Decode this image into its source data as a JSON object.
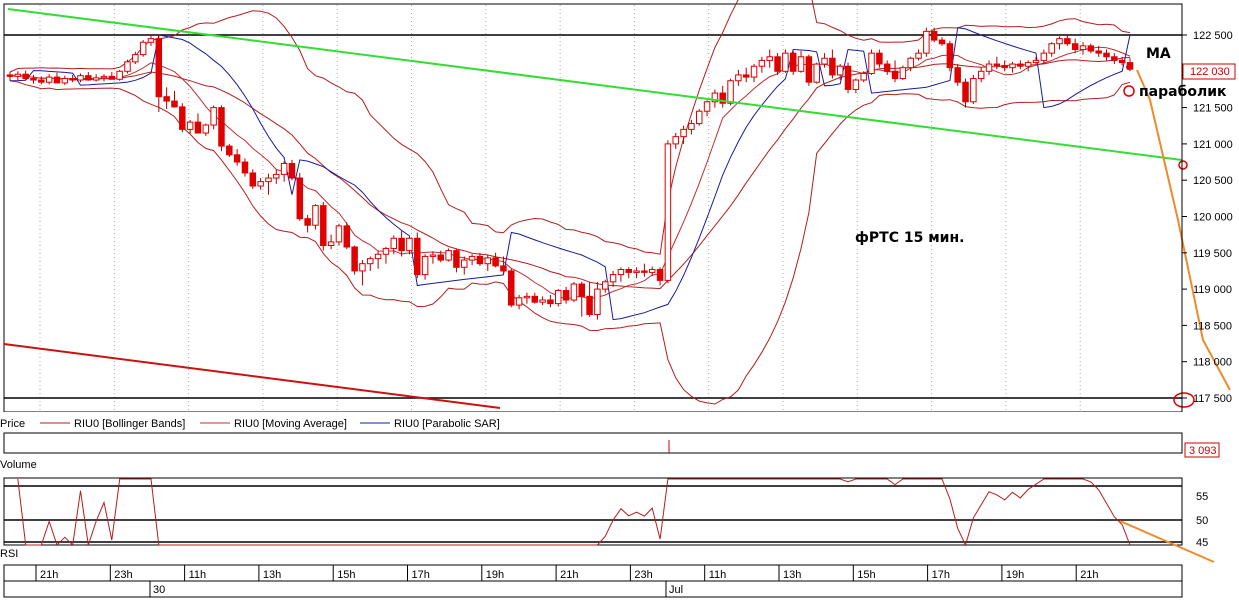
{
  "chart_data": {
    "type": "candlestick",
    "price_panel": {
      "ylim": [
        117500,
        122600
      ],
      "y_ticks": [
        "122 500",
        "122 000",
        "121 500",
        "121 000",
        "120 500",
        "120 000",
        "119 500",
        "119 000",
        "118 500",
        "118 000",
        "117 500"
      ],
      "current_price_label": "122 030",
      "annotations": {
        "ma": "MA",
        "parabolic": "параболик",
        "title": "фРТС   15 мин."
      },
      "legend": [
        "Price",
        "RIU0 [Bollinger Bands]",
        "RIU0 [Moving Average]",
        "RIU0 [Parabolic SAR]"
      ],
      "candles": [
        [
          121950,
          121990,
          121870,
          121930
        ],
        [
          121930,
          122000,
          121880,
          121960
        ],
        [
          121960,
          122010,
          121880,
          121900
        ],
        [
          121900,
          121950,
          121830,
          121880
        ],
        [
          121880,
          121930,
          121820,
          121850
        ],
        [
          121850,
          121960,
          121820,
          121920
        ],
        [
          121920,
          121980,
          121860,
          121840
        ],
        [
          121840,
          121940,
          121810,
          121900
        ],
        [
          121900,
          121950,
          121850,
          121880
        ],
        [
          121880,
          121970,
          121850,
          121940
        ],
        [
          121940,
          121990,
          121870,
          121880
        ],
        [
          121880,
          121960,
          121860,
          121910
        ],
        [
          121910,
          121960,
          121860,
          121930
        ],
        [
          121930,
          121990,
          121890,
          121890
        ],
        [
          121890,
          122020,
          121870,
          122000
        ],
        [
          122000,
          122160,
          121970,
          122130
        ],
        [
          122130,
          122270,
          122100,
          122230
        ],
        [
          122230,
          122430,
          122200,
          122400
        ],
        [
          122400,
          122500,
          122350,
          122450
        ],
        [
          122450,
          122510,
          121440,
          121650
        ],
        [
          121650,
          121780,
          121480,
          121590
        ],
        [
          121590,
          121730,
          121500,
          121510
        ],
        [
          121510,
          121560,
          121160,
          121200
        ],
        [
          121200,
          121330,
          121140,
          121300
        ],
        [
          121300,
          121420,
          121170,
          121150
        ],
        [
          121150,
          121280,
          121110,
          121260
        ],
        [
          121260,
          121530,
          121200,
          121500
        ],
        [
          121500,
          121530,
          120900,
          120970
        ],
        [
          120970,
          121000,
          120820,
          120850
        ],
        [
          120850,
          120930,
          120700,
          120750
        ],
        [
          120750,
          120800,
          120550,
          120600
        ],
        [
          120600,
          120650,
          120380,
          120420
        ],
        [
          120420,
          120530,
          120370,
          120480
        ],
        [
          120480,
          120590,
          120300,
          120530
        ],
        [
          120530,
          120650,
          120450,
          120580
        ],
        [
          120580,
          120760,
          120480,
          120730
        ],
        [
          120730,
          120780,
          120500,
          120530
        ],
        [
          120530,
          120600,
          119940,
          119970
        ],
        [
          119970,
          120020,
          119780,
          119880
        ],
        [
          119880,
          120170,
          119820,
          120150
        ],
        [
          120150,
          120200,
          119530,
          119600
        ],
        [
          119600,
          119750,
          119550,
          119650
        ],
        [
          119650,
          119900,
          119600,
          119870
        ],
        [
          119870,
          119920,
          119550,
          119580
        ],
        [
          119580,
          119600,
          119200,
          119250
        ],
        [
          119250,
          119400,
          119050,
          119350
        ],
        [
          119350,
          119450,
          119250,
          119420
        ],
        [
          119420,
          119530,
          119280,
          119480
        ],
        [
          119480,
          119580,
          119350,
          119560
        ],
        [
          119560,
          119740,
          119480,
          119700
        ],
        [
          119700,
          119800,
          119450,
          119530
        ],
        [
          119530,
          119720,
          119480,
          119700
        ],
        [
          119700,
          119780,
          119150,
          119200
        ],
        [
          119200,
          119480,
          119130,
          119450
        ],
        [
          119450,
          119520,
          119350,
          119470
        ],
        [
          119470,
          119530,
          119370,
          119400
        ],
        [
          119400,
          119560,
          119380,
          119530
        ],
        [
          119530,
          119560,
          119230,
          119300
        ],
        [
          119300,
          119450,
          119200,
          119400
        ],
        [
          119400,
          119480,
          119330,
          119450
        ],
        [
          119450,
          119500,
          119320,
          119350
        ],
        [
          119350,
          119470,
          119250,
          119430
        ],
        [
          119430,
          119500,
          119300,
          119320
        ],
        [
          119320,
          119450,
          119200,
          119250
        ],
        [
          119250,
          119280,
          118750,
          118780
        ],
        [
          118780,
          118920,
          118720,
          118880
        ],
        [
          118880,
          118950,
          118800,
          118900
        ],
        [
          118900,
          118950,
          118800,
          118820
        ],
        [
          118820,
          118900,
          118780,
          118850
        ],
        [
          118850,
          118920,
          118750,
          118800
        ],
        [
          118800,
          119000,
          118760,
          118980
        ],
        [
          118980,
          119030,
          118800,
          118850
        ],
        [
          118850,
          119100,
          118820,
          119070
        ],
        [
          119070,
          119100,
          118620,
          118900
        ],
        [
          118900,
          119100,
          118620,
          118650
        ],
        [
          118650,
          119100,
          118580,
          119000
        ],
        [
          119000,
          119130,
          118950,
          119100
        ],
        [
          119100,
          119250,
          119030,
          119200
        ],
        [
          119200,
          119300,
          119100,
          119270
        ],
        [
          119270,
          119300,
          119150,
          119230
        ],
        [
          119230,
          119300,
          119150,
          119250
        ],
        [
          119250,
          119350,
          119170,
          119230
        ],
        [
          119230,
          119310,
          119180,
          119270
        ],
        [
          119270,
          119300,
          119050,
          119120
        ],
        [
          119120,
          121050,
          119080,
          121000
        ],
        [
          121000,
          121150,
          120930,
          121100
        ],
        [
          121100,
          121250,
          121000,
          121200
        ],
        [
          121200,
          121330,
          121130,
          121280
        ],
        [
          121280,
          121480,
          121250,
          121450
        ],
        [
          121450,
          121600,
          121380,
          121580
        ],
        [
          121580,
          121750,
          121500,
          121700
        ],
        [
          121700,
          121800,
          121500,
          121560
        ],
        [
          121560,
          121900,
          121530,
          121870
        ],
        [
          121870,
          122020,
          121800,
          121950
        ],
        [
          121950,
          122050,
          121850,
          121920
        ],
        [
          121920,
          122100,
          121850,
          122070
        ],
        [
          122070,
          122200,
          121980,
          122150
        ],
        [
          122150,
          122300,
          122050,
          122200
        ],
        [
          122200,
          122250,
          121950,
          122000
        ],
        [
          122000,
          122300,
          121980,
          122250
        ],
        [
          122250,
          122280,
          121950,
          122000
        ],
        [
          122000,
          122280,
          121980,
          122200
        ],
        [
          122200,
          122230,
          121800,
          121850
        ],
        [
          121850,
          122120,
          121830,
          122100
        ],
        [
          122100,
          122250,
          122050,
          122180
        ],
        [
          122180,
          122300,
          121900,
          121950
        ],
        [
          121950,
          122100,
          121880,
          122070
        ],
        [
          122070,
          122120,
          121700,
          121750
        ],
        [
          121750,
          121900,
          121700,
          121880
        ],
        [
          121880,
          122000,
          121850,
          121970
        ],
        [
          121970,
          122300,
          121950,
          122250
        ],
        [
          122250,
          122300,
          122050,
          122100
        ],
        [
          122100,
          122150,
          121950,
          122000
        ],
        [
          122000,
          122150,
          121850,
          121900
        ],
        [
          121900,
          122080,
          121880,
          122050
        ],
        [
          122050,
          122200,
          122000,
          122180
        ],
        [
          122180,
          122300,
          122150,
          122250
        ],
        [
          122250,
          122600,
          122200,
          122550
        ],
        [
          122550,
          122600,
          122400,
          122430
        ],
        [
          122430,
          122470,
          122350,
          122380
        ],
        [
          122380,
          122420,
          122000,
          122050
        ],
        [
          122050,
          122100,
          121800,
          121850
        ],
        [
          121850,
          121900,
          121500,
          121580
        ],
        [
          121580,
          121950,
          121550,
          121900
        ],
        [
          121900,
          122050,
          121850,
          122000
        ],
        [
          122000,
          122150,
          121950,
          122100
        ],
        [
          122100,
          122200,
          122030,
          122080
        ],
        [
          122080,
          122150,
          122000,
          122050
        ],
        [
          122050,
          122130,
          121980,
          122100
        ],
        [
          122100,
          122150,
          122030,
          122070
        ],
        [
          122070,
          122150,
          122000,
          122120
        ],
        [
          122120,
          122200,
          122080,
          122150
        ],
        [
          122150,
          122300,
          122100,
          122250
        ],
        [
          122250,
          122400,
          122200,
          122380
        ],
        [
          122380,
          122480,
          122300,
          122450
        ],
        [
          122450,
          122500,
          122350,
          122380
        ],
        [
          122380,
          122450,
          122250,
          122300
        ],
        [
          122300,
          122400,
          122230,
          122350
        ],
        [
          122350,
          122380,
          122250,
          122280
        ],
        [
          122280,
          122350,
          122200,
          122250
        ],
        [
          122250,
          122300,
          122150,
          122200
        ],
        [
          122200,
          122250,
          122100,
          122150
        ],
        [
          122150,
          122200,
          122080,
          122120
        ],
        [
          122120,
          122180,
          122000,
          122030
        ]
      ]
    },
    "volume_panel": {
      "label": "Volume",
      "value_label": "3 093"
    },
    "rsi_panel": {
      "label": "RSI",
      "y_ticks": [
        "55",
        "50",
        "45"
      ]
    },
    "x_axis": {
      "ticks": [
        "21h",
        "23h",
        "11h",
        "13h",
        "15h",
        "17h",
        "19h",
        "21h",
        "23h",
        "11h",
        "13h",
        "15h",
        "17h",
        "19h",
        "21h"
      ],
      "dates": [
        "30",
        "Jul"
      ]
    },
    "colors": {
      "bull": "#ffffff",
      "bear": "#e00000",
      "wick": "#b00000",
      "bollinger": "#b41e1e",
      "ma": "#c03030",
      "sar": "#1a1aa0",
      "trend_green": "#33dd33",
      "trend_red": "#cc1111",
      "forecast": "#ee8a2a"
    }
  }
}
